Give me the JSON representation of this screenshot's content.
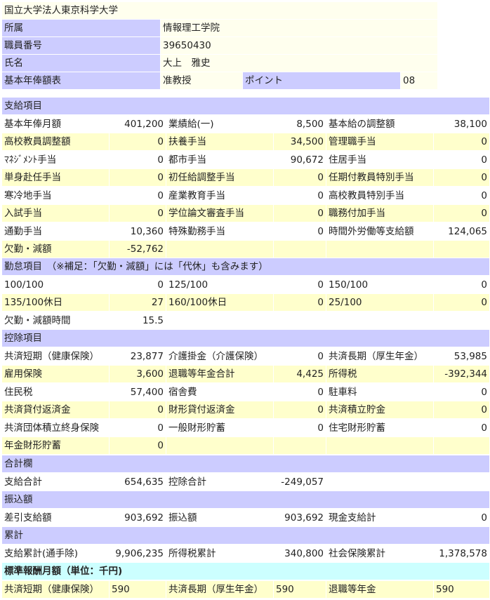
{
  "university": "国立大学法人東京科学大学",
  "header_info": [
    {
      "label": "所属",
      "value": "情報理工学院"
    },
    {
      "label": "職員番号",
      "value": "39650430"
    },
    {
      "label": "氏名",
      "value": "大上　雅史"
    },
    {
      "label": "基本年俸額表",
      "value": "准教授",
      "label2": "ポイント",
      "value2": "08"
    }
  ],
  "sections": {
    "pay": {
      "title": "支給項目",
      "rows": [
        [
          {
            "label": "基本年俸月額",
            "value": "401,200"
          },
          {
            "label": "業績給(一)",
            "value": "8,500"
          },
          {
            "label": "基本給の調整額",
            "value": "38,100"
          }
        ],
        [
          {
            "label": "高校教員調整額",
            "value": "0"
          },
          {
            "label": "扶養手当",
            "value": "34,500"
          },
          {
            "label": "管理職手当",
            "value": "0"
          }
        ],
        [
          {
            "label": "ﾏﾈｼﾞﾒﾝﾄ手当",
            "value": "0"
          },
          {
            "label": "都市手当",
            "value": "90,672"
          },
          {
            "label": "住居手当",
            "value": "0"
          }
        ],
        [
          {
            "label": "単身赴任手当",
            "value": "0"
          },
          {
            "label": "初任給調整手当",
            "value": "0"
          },
          {
            "label": "任期付教員特別手当",
            "value": "0"
          }
        ],
        [
          {
            "label": "寒冷地手当",
            "value": "0"
          },
          {
            "label": "産業教育手当",
            "value": "0"
          },
          {
            "label": "高校教員特別手当",
            "value": "0"
          }
        ],
        [
          {
            "label": "入試手当",
            "value": "0"
          },
          {
            "label": "学位論文審査手当",
            "value": "0"
          },
          {
            "label": "職務付加手当",
            "value": "0"
          }
        ],
        [
          {
            "label": "通勤手当",
            "value": "10,360"
          },
          {
            "label": "特殊勤務手当",
            "value": "0"
          },
          {
            "label": "時間外労働等支給額",
            "value": "124,065"
          }
        ],
        [
          {
            "label": "欠勤・減額",
            "value": "-52,762"
          },
          {
            "label": "",
            "value": ""
          },
          {
            "label": "",
            "value": ""
          }
        ]
      ]
    },
    "attendance": {
      "title": "勤怠項目　（※補足：「欠勤・減額」には「代休」も含みます）",
      "rows": [
        [
          {
            "label": "100/100",
            "value": "0"
          },
          {
            "label": "125/100",
            "value": "0"
          },
          {
            "label": "150/100",
            "value": "0"
          }
        ],
        [
          {
            "label": "135/100休日",
            "value": "27"
          },
          {
            "label": "160/100休日",
            "value": "0"
          },
          {
            "label": "25/100",
            "value": "0"
          }
        ],
        [
          {
            "label": "欠勤・減額時間",
            "value": "15.5"
          },
          {
            "label": "",
            "value": ""
          },
          {
            "label": "",
            "value": ""
          }
        ]
      ]
    },
    "deduction": {
      "title": "控除項目",
      "rows": [
        [
          {
            "label": "共済短期（健康保険）",
            "value": "23,877"
          },
          {
            "label": "介護掛金（介護保険）",
            "value": "0"
          },
          {
            "label": "共済長期（厚生年金）",
            "value": "53,985"
          }
        ],
        [
          {
            "label": "雇用保険",
            "value": "3,600"
          },
          {
            "label": "退職等年金合計",
            "value": "4,425"
          },
          {
            "label": "所得税",
            "value": "-392,344"
          }
        ],
        [
          {
            "label": "住民税",
            "value": "57,400"
          },
          {
            "label": "宿舎費",
            "value": "0"
          },
          {
            "label": "駐車料",
            "value": "0"
          }
        ],
        [
          {
            "label": "共済貸付返済金",
            "value": "0"
          },
          {
            "label": "財形貸付返済金",
            "value": "0"
          },
          {
            "label": "共済積立貯金",
            "value": "0"
          }
        ],
        [
          {
            "label": "共済団体積立終身保険",
            "value": "0"
          },
          {
            "label": "一般財形貯蓄",
            "value": "0"
          },
          {
            "label": "住宅財形貯蓄",
            "value": "0"
          }
        ],
        [
          {
            "label": "年金財形貯蓄",
            "value": "0"
          },
          {
            "label": "",
            "value": ""
          },
          {
            "label": "",
            "value": ""
          }
        ]
      ]
    },
    "totals": {
      "title": "合計欄",
      "rows": [
        [
          {
            "label": "支給合計",
            "value": "654,635"
          },
          {
            "label": "控除合計",
            "value": "-249,057"
          },
          {
            "label": "",
            "value": ""
          }
        ]
      ]
    },
    "transfer": {
      "title": "振込額",
      "rows": [
        [
          {
            "label": "差引支給額",
            "value": "903,692"
          },
          {
            "label": "振込額",
            "value": "903,692"
          },
          {
            "label": "現金支給計",
            "value": "0"
          }
        ]
      ]
    },
    "cumulative": {
      "title": "累計",
      "rows": [
        [
          {
            "label": "支給累計(通手除)",
            "value": "9,906,235"
          },
          {
            "label": "所得税累計",
            "value": "340,800"
          },
          {
            "label": "社会保険累計",
            "value": "1,378,578"
          }
        ]
      ]
    },
    "standard": {
      "title": "標準報酬月額（単位：千円)",
      "rows": [
        [
          {
            "label": "共済短期（健康保険）",
            "value": "590"
          },
          {
            "label": "共済長期（厚生年金）",
            "value": "590"
          },
          {
            "label": "退職等年金",
            "value": "590"
          }
        ]
      ]
    }
  },
  "colors": {
    "header_bg": "#ccccff",
    "row_cream": "#ffffee",
    "row_yellow": "#ffffcc",
    "standard_header": "#ccffff"
  }
}
